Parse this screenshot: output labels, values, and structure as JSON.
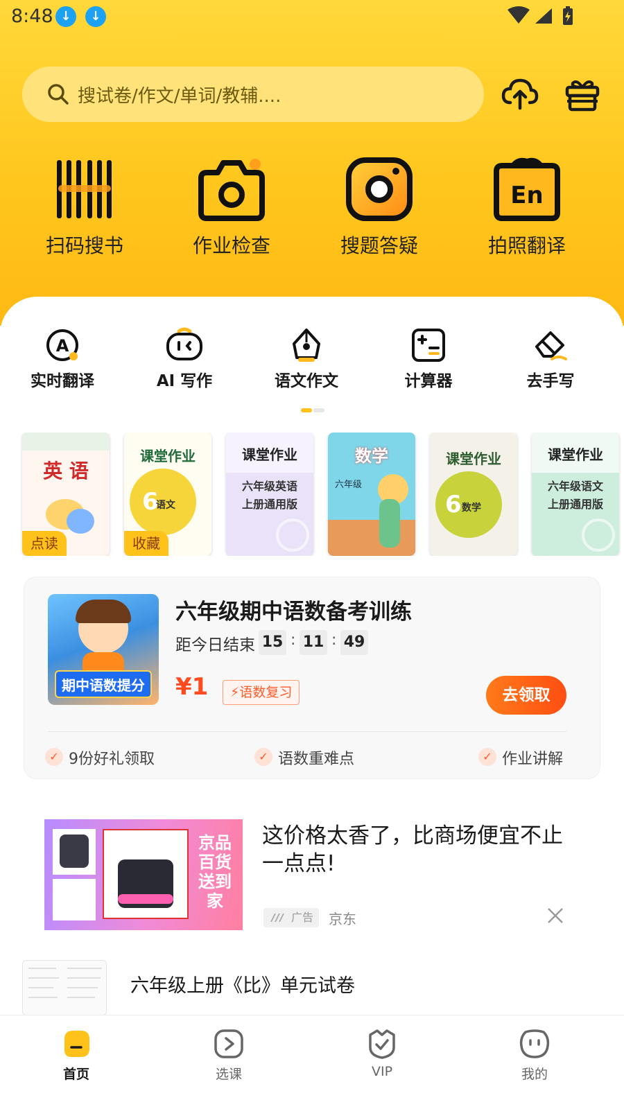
{
  "status_bar": {
    "time": "8:48"
  },
  "search": {
    "placeholder": "搜试卷/作文/单词/教辅...."
  },
  "header_actions": {
    "upload": "upload-icon",
    "gift": "gift-icon"
  },
  "main_tools": [
    {
      "label": "扫码搜书",
      "icon": "barcode-icon"
    },
    {
      "label": "作业检查",
      "icon": "camera-icon"
    },
    {
      "label": "搜题答疑",
      "icon": "search-camera-icon"
    },
    {
      "label": "拍照翻译",
      "icon": "translate-camera-icon"
    }
  ],
  "sub_tools": [
    {
      "label": "实时翻译",
      "icon": "realtime-translate-icon"
    },
    {
      "label": "AI 写作",
      "icon": "ai-writing-icon"
    },
    {
      "label": "语文作文",
      "icon": "pen-nib-icon"
    },
    {
      "label": "计算器",
      "icon": "calculator-icon"
    },
    {
      "label": "去手写",
      "icon": "eraser-icon"
    }
  ],
  "books": [
    {
      "title": "英 语",
      "badge": "点读"
    },
    {
      "title": "课堂作业",
      "subtitle": "语文",
      "grade": "6",
      "badge": "收藏"
    },
    {
      "title": "课堂作业",
      "caption_line1": "六年级英语",
      "caption_line2": "上册通用版"
    },
    {
      "title": "数学",
      "grade_text": "六年级"
    },
    {
      "title": "课堂作业",
      "subtitle": "数学",
      "grade": "6"
    },
    {
      "title": "课堂作业",
      "caption_line1": "六年级语文",
      "caption_line2": "上册通用版"
    }
  ],
  "promo": {
    "image_label": "期中语数提分",
    "title": "六年级期中语数备考训练",
    "countdown_label": "距今日结束",
    "countdown": {
      "h": "15",
      "m": "11",
      "s": "49"
    },
    "price": "¥1",
    "tag": "语数复习",
    "cta": "去领取",
    "benefits": [
      "9份好礼领取",
      "语数重难点",
      "作业讲解"
    ]
  },
  "ad": {
    "image_text": "京品百货送到家",
    "title": "这价格太香了，比商场便宜不止一点点!",
    "badge": "广告",
    "source": "京东"
  },
  "exam": {
    "title": "六年级上册《比》单元试卷"
  },
  "bottom_nav": [
    {
      "label": "首页",
      "icon": "home-icon",
      "active": true
    },
    {
      "label": "选课",
      "icon": "play-course-icon",
      "active": false
    },
    {
      "label": "VIP",
      "icon": "vip-shield-icon",
      "active": false
    },
    {
      "label": "我的",
      "icon": "profile-face-icon",
      "active": false
    }
  ],
  "colors": {
    "accent_yellow": "#FFC71E",
    "cta_orange": "#FF5A1A",
    "price_red": "#FF4B1F"
  }
}
